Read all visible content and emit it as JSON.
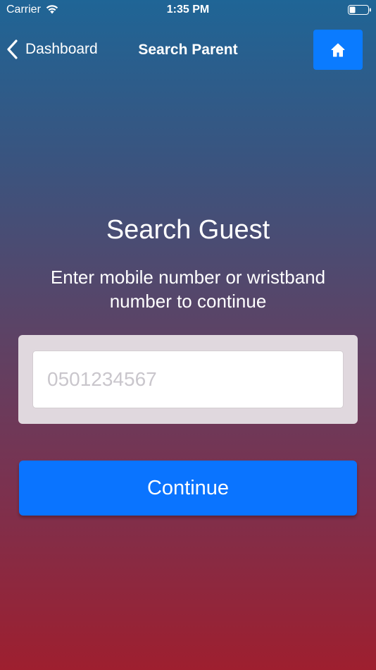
{
  "status_bar": {
    "carrier": "Carrier",
    "time": "1:35 PM",
    "wifi_icon": "wifi-icon",
    "battery_icon": "battery-icon"
  },
  "nav": {
    "back_label": "Dashboard",
    "back_icon": "chevron-left-icon",
    "title": "Search Parent",
    "home_icon": "home-icon"
  },
  "main": {
    "title": "Search Guest",
    "subtitle": "Enter mobile number or wristband number to continue",
    "search": {
      "placeholder": "0501234567",
      "value": ""
    },
    "continue_label": "Continue"
  },
  "colors": {
    "accent": "#0a74ff",
    "gradient_top": "#1f6596",
    "gradient_bottom": "#9e1f2f",
    "card_background": "#e0d8de"
  }
}
